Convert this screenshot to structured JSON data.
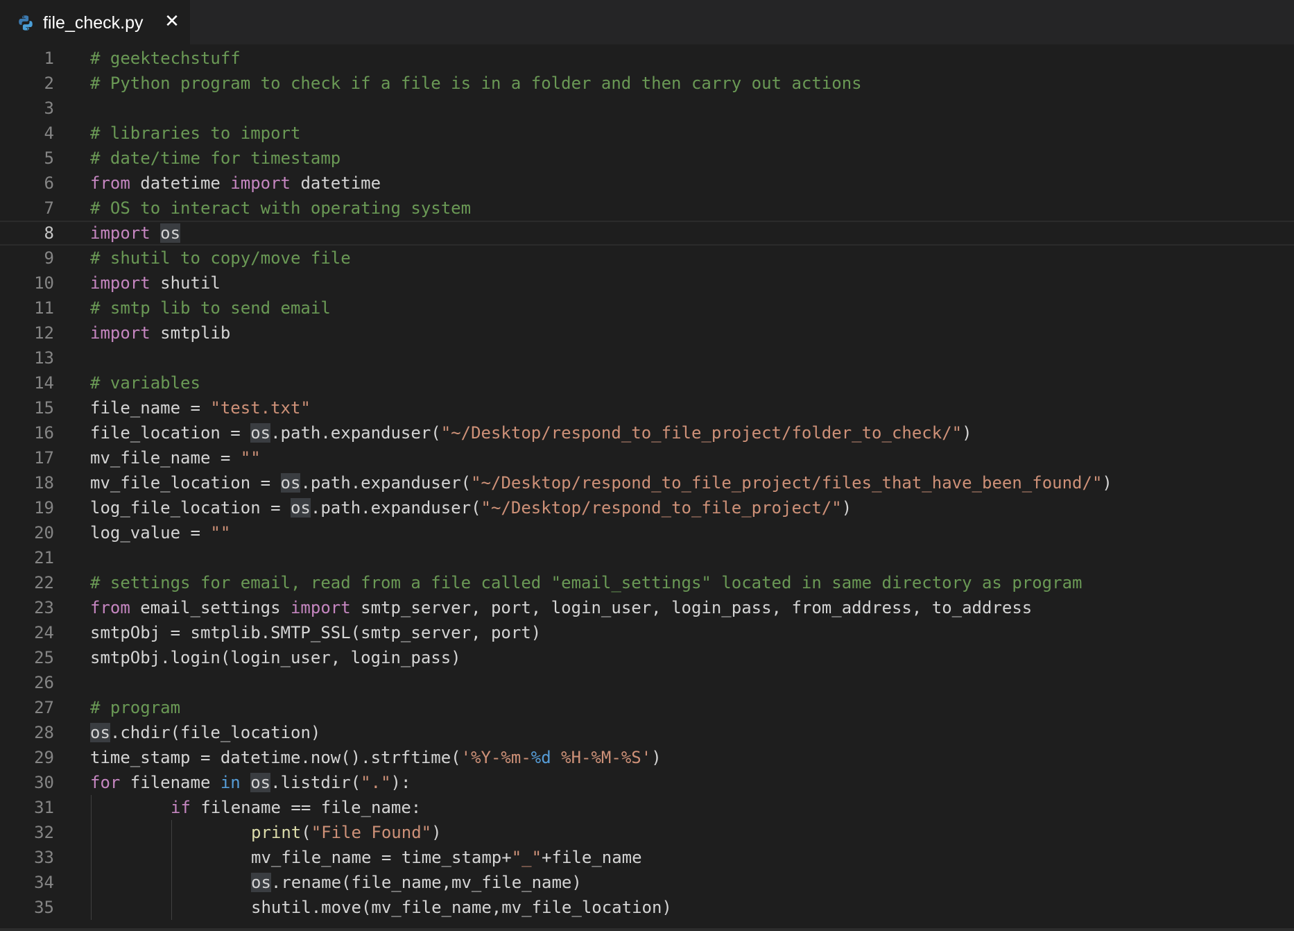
{
  "tab": {
    "filename": "file_check.py",
    "file_type_icon": "python-icon",
    "close_glyph": "✕",
    "close_icon": "close-icon"
  },
  "colors": {
    "background": "#1e1e1e",
    "comment": "#6a9955",
    "keyword": "#c586c0",
    "builtin_keyword": "#569cd6",
    "string": "#ce9178",
    "function": "#dcdcaa",
    "default_text": "#d4d4d4",
    "selection_highlight": "#3a3d41"
  },
  "editor": {
    "active_line": 8,
    "lines": [
      {
        "n": "1",
        "indent": 0,
        "tokens": [
          {
            "t": "# geektechstuff",
            "c": "comment"
          }
        ]
      },
      {
        "n": "2",
        "indent": 0,
        "tokens": [
          {
            "t": "# Python program to check if a file is in a folder and then carry out actions",
            "c": "comment"
          }
        ]
      },
      {
        "n": "3",
        "indent": 0,
        "tokens": []
      },
      {
        "n": "4",
        "indent": 0,
        "tokens": [
          {
            "t": "# libraries to import",
            "c": "comment"
          }
        ]
      },
      {
        "n": "5",
        "indent": 0,
        "tokens": [
          {
            "t": "# date/time for timestamp",
            "c": "comment"
          }
        ]
      },
      {
        "n": "6",
        "indent": 0,
        "tokens": [
          {
            "t": "from",
            "c": "keyword"
          },
          {
            "t": " datetime ",
            "c": "plain"
          },
          {
            "t": "import",
            "c": "keyword"
          },
          {
            "t": " datetime",
            "c": "plain"
          }
        ]
      },
      {
        "n": "7",
        "indent": 0,
        "tokens": [
          {
            "t": "# OS to interact with operating system",
            "c": "comment"
          }
        ]
      },
      {
        "n": "8",
        "indent": 0,
        "tokens": [
          {
            "t": "import",
            "c": "keyword"
          },
          {
            "t": " ",
            "c": "plain"
          },
          {
            "t": "os",
            "c": "plain",
            "hl": true
          }
        ]
      },
      {
        "n": "9",
        "indent": 0,
        "tokens": [
          {
            "t": "# shutil to copy/move file",
            "c": "comment"
          }
        ]
      },
      {
        "n": "10",
        "indent": 0,
        "tokens": [
          {
            "t": "import",
            "c": "keyword"
          },
          {
            "t": " shutil",
            "c": "plain"
          }
        ]
      },
      {
        "n": "11",
        "indent": 0,
        "tokens": [
          {
            "t": "# smtp lib to send email",
            "c": "comment"
          }
        ]
      },
      {
        "n": "12",
        "indent": 0,
        "tokens": [
          {
            "t": "import",
            "c": "keyword"
          },
          {
            "t": " smtplib",
            "c": "plain"
          }
        ]
      },
      {
        "n": "13",
        "indent": 0,
        "tokens": []
      },
      {
        "n": "14",
        "indent": 0,
        "tokens": [
          {
            "t": "# variables",
            "c": "comment"
          }
        ]
      },
      {
        "n": "15",
        "indent": 0,
        "tokens": [
          {
            "t": "file_name = ",
            "c": "plain"
          },
          {
            "t": "\"test.txt\"",
            "c": "string"
          }
        ]
      },
      {
        "n": "16",
        "indent": 0,
        "tokens": [
          {
            "t": "file_location = ",
            "c": "plain"
          },
          {
            "t": "os",
            "c": "plain",
            "hl": true
          },
          {
            "t": ".path.expanduser(",
            "c": "plain"
          },
          {
            "t": "\"~/Desktop/respond_to_file_project/folder_to_check/\"",
            "c": "string"
          },
          {
            "t": ")",
            "c": "plain"
          }
        ]
      },
      {
        "n": "17",
        "indent": 0,
        "tokens": [
          {
            "t": "mv_file_name = ",
            "c": "plain"
          },
          {
            "t": "\"\"",
            "c": "string"
          }
        ]
      },
      {
        "n": "18",
        "indent": 0,
        "tokens": [
          {
            "t": "mv_file_location = ",
            "c": "plain"
          },
          {
            "t": "os",
            "c": "plain",
            "hl": true
          },
          {
            "t": ".path.expanduser(",
            "c": "plain"
          },
          {
            "t": "\"~/Desktop/respond_to_file_project/files_that_have_been_found/\"",
            "c": "string"
          },
          {
            "t": ")",
            "c": "plain"
          }
        ]
      },
      {
        "n": "19",
        "indent": 0,
        "tokens": [
          {
            "t": "log_file_location = ",
            "c": "plain"
          },
          {
            "t": "os",
            "c": "plain",
            "hl": true
          },
          {
            "t": ".path.expanduser(",
            "c": "plain"
          },
          {
            "t": "\"~/Desktop/respond_to_file_project/\"",
            "c": "string"
          },
          {
            "t": ")",
            "c": "plain"
          }
        ]
      },
      {
        "n": "20",
        "indent": 0,
        "tokens": [
          {
            "t": "log_value = ",
            "c": "plain"
          },
          {
            "t": "\"\"",
            "c": "string"
          }
        ]
      },
      {
        "n": "21",
        "indent": 0,
        "tokens": []
      },
      {
        "n": "22",
        "indent": 0,
        "tokens": [
          {
            "t": "# settings for email, read from a file called \"email_settings\" located in same directory as program",
            "c": "comment"
          }
        ]
      },
      {
        "n": "23",
        "indent": 0,
        "tokens": [
          {
            "t": "from",
            "c": "keyword"
          },
          {
            "t": " email_settings ",
            "c": "plain"
          },
          {
            "t": "import",
            "c": "keyword"
          },
          {
            "t": " smtp_server, port, login_user, login_pass, from_address, to_address",
            "c": "plain"
          }
        ]
      },
      {
        "n": "24",
        "indent": 0,
        "tokens": [
          {
            "t": "smtpObj = smtplib.SMTP_SSL(smtp_server, port)",
            "c": "plain"
          }
        ]
      },
      {
        "n": "25",
        "indent": 0,
        "tokens": [
          {
            "t": "smtpObj.login(login_user, login_pass)",
            "c": "plain"
          }
        ]
      },
      {
        "n": "26",
        "indent": 0,
        "tokens": []
      },
      {
        "n": "27",
        "indent": 0,
        "tokens": [
          {
            "t": "# program",
            "c": "comment"
          }
        ]
      },
      {
        "n": "28",
        "indent": 0,
        "tokens": [
          {
            "t": "os",
            "c": "plain",
            "hl": true
          },
          {
            "t": ".chdir(file_location)",
            "c": "plain"
          }
        ]
      },
      {
        "n": "29",
        "indent": 0,
        "tokens": [
          {
            "t": "time_stamp = datetime.now().strftime(",
            "c": "plain"
          },
          {
            "t": "'%Y-%m-",
            "c": "string"
          },
          {
            "t": "%d",
            "c": "builtin"
          },
          {
            "t": " %H-%M-%S'",
            "c": "string"
          },
          {
            "t": ")",
            "c": "plain"
          }
        ]
      },
      {
        "n": "30",
        "indent": 0,
        "tokens": [
          {
            "t": "for",
            "c": "keyword"
          },
          {
            "t": " filename ",
            "c": "plain"
          },
          {
            "t": "in",
            "c": "builtin"
          },
          {
            "t": " ",
            "c": "plain"
          },
          {
            "t": "os",
            "c": "plain",
            "hl": true
          },
          {
            "t": ".listdir(",
            "c": "plain"
          },
          {
            "t": "\".\"",
            "c": "string"
          },
          {
            "t": "):",
            "c": "plain"
          }
        ]
      },
      {
        "n": "31",
        "indent": 1,
        "tokens": [
          {
            "t": "if",
            "c": "keyword"
          },
          {
            "t": " filename == file_name:",
            "c": "plain"
          }
        ]
      },
      {
        "n": "32",
        "indent": 2,
        "tokens": [
          {
            "t": "print",
            "c": "func"
          },
          {
            "t": "(",
            "c": "plain"
          },
          {
            "t": "\"File Found\"",
            "c": "string"
          },
          {
            "t": ")",
            "c": "plain"
          }
        ]
      },
      {
        "n": "33",
        "indent": 2,
        "tokens": [
          {
            "t": "mv_file_name = time_stamp+",
            "c": "plain"
          },
          {
            "t": "\"_\"",
            "c": "string"
          },
          {
            "t": "+file_name",
            "c": "plain"
          }
        ]
      },
      {
        "n": "34",
        "indent": 2,
        "tokens": [
          {
            "t": "os",
            "c": "plain",
            "hl": true
          },
          {
            "t": ".rename(file_name,mv_file_name)",
            "c": "plain"
          }
        ]
      },
      {
        "n": "35",
        "indent": 2,
        "tokens": [
          {
            "t": "shutil.move(mv_file_name,mv_file_location)",
            "c": "plain"
          }
        ]
      }
    ]
  }
}
